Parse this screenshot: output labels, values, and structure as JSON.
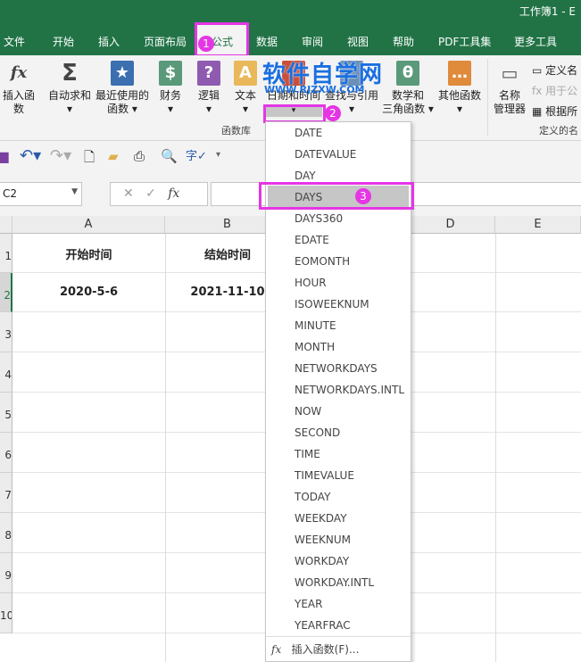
{
  "title": "工作簿1 - E",
  "tabs": [
    "文件",
    "开始",
    "插入",
    "页面布局",
    "公式",
    "数据",
    "审阅",
    "视图",
    "帮助",
    "PDF工具集",
    "更多工具"
  ],
  "ribbon": {
    "insert_function": "插入函数",
    "autosum": "自动求和",
    "recent": "最近使用的",
    "recent2": "函数",
    "financial": "财务",
    "logical": "逻辑",
    "text": "文本",
    "datetime": "日期和时间",
    "lookup": "查找与引用",
    "math": "数学和",
    "math2": "三角函数",
    "other": "其他函数",
    "name_mgr": "名称",
    "name_mgr2": "管理器",
    "define_name": "定义名",
    "use_in": "用于公",
    "create_from": "根据所",
    "group_lib": "函数库",
    "group_names": "定义的名"
  },
  "watermark": {
    "cn": "软件自学网",
    "url": "WWW.RJZXW.COM"
  },
  "namebox": "C2",
  "columns": [
    "A",
    "B",
    "D",
    "E"
  ],
  "rows": [
    "1",
    "2",
    "3",
    "4",
    "5",
    "6",
    "7",
    "8",
    "9",
    "10"
  ],
  "cells": {
    "a1": "开始时间",
    "b1": "结始时间",
    "a2": "2020-5-6",
    "b2": "2021-11-10"
  },
  "menu": {
    "items": [
      "DATE",
      "DATEVALUE",
      "DAY",
      "DAYS",
      "DAYS360",
      "EDATE",
      "EOMONTH",
      "HOUR",
      "ISOWEEKNUM",
      "MINUTE",
      "MONTH",
      "NETWORKDAYS",
      "NETWORKDAYS.INTL",
      "NOW",
      "SECOND",
      "TIME",
      "TIMEVALUE",
      "TODAY",
      "WEEKDAY",
      "WEEKNUM",
      "WORKDAY",
      "WORKDAY.INTL",
      "YEAR",
      "YEARFRAC"
    ],
    "selected": "DAYS",
    "insert_function": "插入函数(F)..."
  },
  "badges": [
    "1",
    "2",
    "3"
  ],
  "colors": {
    "excel_green": "#217346",
    "highlight": "#e436e4"
  }
}
